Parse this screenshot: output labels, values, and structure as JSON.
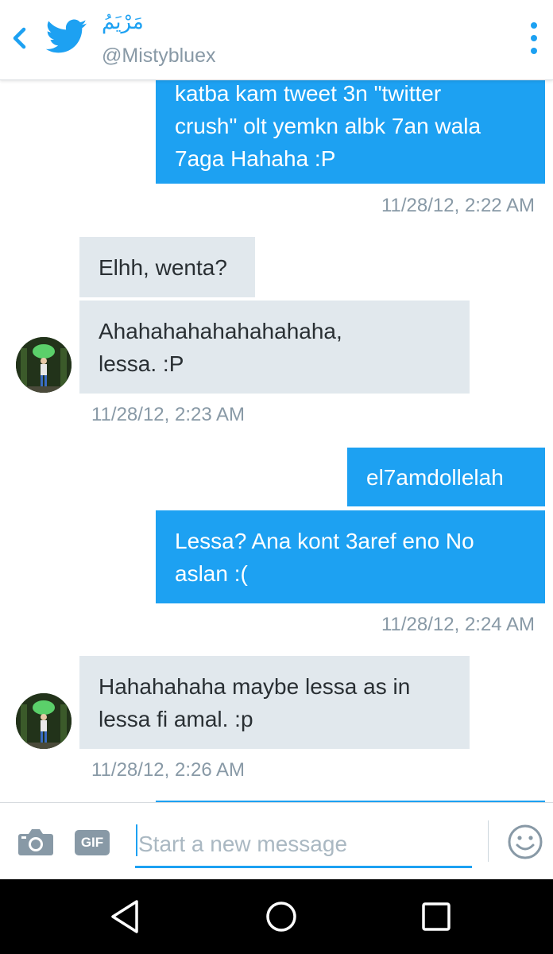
{
  "header": {
    "name": "مَرْيَمُ",
    "handle": "@Mistybluex"
  },
  "colors": {
    "accent": "#1da1f2",
    "incoming_bubble": "#e1e8ed",
    "timestamp": "#8899a6"
  },
  "icons": {
    "back": "chevron-left-icon",
    "logo": "twitter-bird-icon",
    "menu": "overflow-menu-icon",
    "camera": "camera-icon",
    "gif": "gif-icon",
    "emoji": "smiley-icon"
  },
  "messages": [
    {
      "direction": "out",
      "lines": [
        "katba kam tweet 3n \"twitter",
        "crush\" olt yemkn albk 7an wala",
        "7aga Hahaha :P"
      ]
    },
    {
      "timestamp": "11/28/12, 2:22 AM"
    },
    {
      "direction": "in",
      "lines": [
        "Elhh, wenta?"
      ]
    },
    {
      "direction": "in",
      "lines": [
        "Ahahahahahahahahaha,",
        "lessa. :P"
      ]
    },
    {
      "timestamp": "11/28/12, 2:23 AM"
    },
    {
      "direction": "out",
      "lines": [
        "el7amdollelah"
      ]
    },
    {
      "direction": "out",
      "lines": [
        "Lessa? Ana kont 3aref eno No",
        "aslan :("
      ]
    },
    {
      "timestamp": "11/28/12, 2:24 AM"
    },
    {
      "direction": "in",
      "lines": [
        "Hahahahaha maybe lessa as in",
        "lessa fi amal. :p"
      ]
    },
    {
      "timestamp": "11/28/12, 2:26 AM"
    }
  ],
  "composer": {
    "placeholder": "Start a new message",
    "gif_label": "GIF"
  }
}
